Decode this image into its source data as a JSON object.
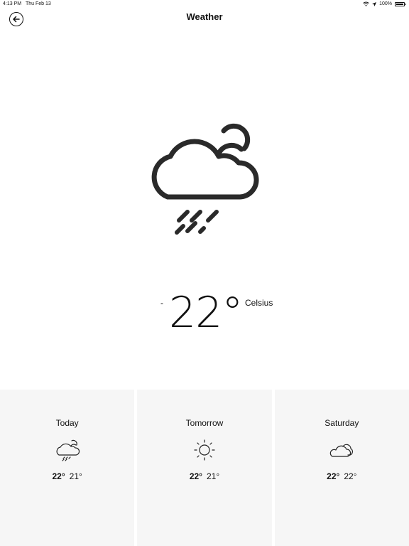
{
  "status_bar": {
    "time": "4:13 PM",
    "date": "Thu Feb 13",
    "battery": "100%"
  },
  "nav": {
    "title": "Weather"
  },
  "current": {
    "sign": "-",
    "temperature": "22°",
    "unit": "Celsius",
    "icon": "cloud-rain-moon-icon"
  },
  "forecast": [
    {
      "day": "Today",
      "high": "22°",
      "low": "21°",
      "icon": "cloud-rain-moon-icon"
    },
    {
      "day": "Tomorrow",
      "high": "22°",
      "low": "21°",
      "icon": "sun-icon"
    },
    {
      "day": "Saturday",
      "high": "22°",
      "low": "22°",
      "icon": "clouds-icon"
    }
  ],
  "colors": {
    "background": "#ffffff",
    "card": "#f6f6f6",
    "icon": "#2a2a2a"
  }
}
